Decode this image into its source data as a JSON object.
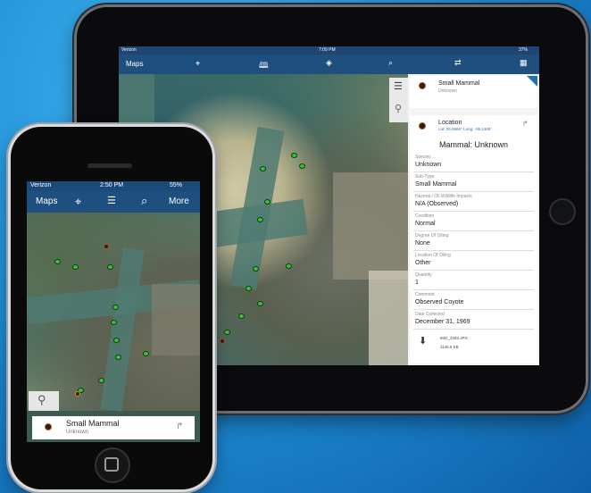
{
  "ipad": {
    "status": {
      "carrier": "Verizon",
      "time": "7:09 PM",
      "battery": "37%"
    },
    "nav": {
      "maps_label": "Maps",
      "icons": [
        "location-icon",
        "book-icon",
        "layers-icon",
        "search-icon",
        "sync-icon",
        "qr-icon"
      ]
    },
    "list_item": {
      "title": "Small Mammal",
      "subtitle": "Unknown"
    },
    "detail": {
      "location_title": "Location",
      "location_coords": "Lat: 29.0866° Long: -95.1369°",
      "heading": "Mammal: Unknown",
      "fields": [
        {
          "label": "Species",
          "value": "Unknown"
        },
        {
          "label": "Sub-Type",
          "value": "Small Mammal"
        },
        {
          "label": "Hazmat / Oil Wildlife Impacts",
          "value": "N/A (Observed)"
        },
        {
          "label": "Condition",
          "value": "Normal"
        },
        {
          "label": "Degree Of Oiling",
          "value": "None"
        },
        {
          "label": "Location Of Oiling",
          "value": "Other"
        },
        {
          "label": "Quantity",
          "value": "1"
        },
        {
          "label": "Comment",
          "value": "Observed Coyote"
        },
        {
          "label": "Date Collected",
          "value": "December 31, 1969"
        }
      ],
      "attachment": {
        "name": "IMG_2293.JPG",
        "size": "1146.6 KB"
      }
    }
  },
  "iphone": {
    "status": {
      "carrier": "Verizon",
      "time": "2:50 PM",
      "battery": "55%"
    },
    "nav": {
      "maps_label": "Maps",
      "more_label": "More"
    },
    "card": {
      "title": "Small Mammal",
      "subtitle": "Unknown"
    }
  },
  "colors": {
    "nav": "#1e4f7e",
    "accent": "#1f6fb8",
    "marker_green": "#3ac13a"
  }
}
